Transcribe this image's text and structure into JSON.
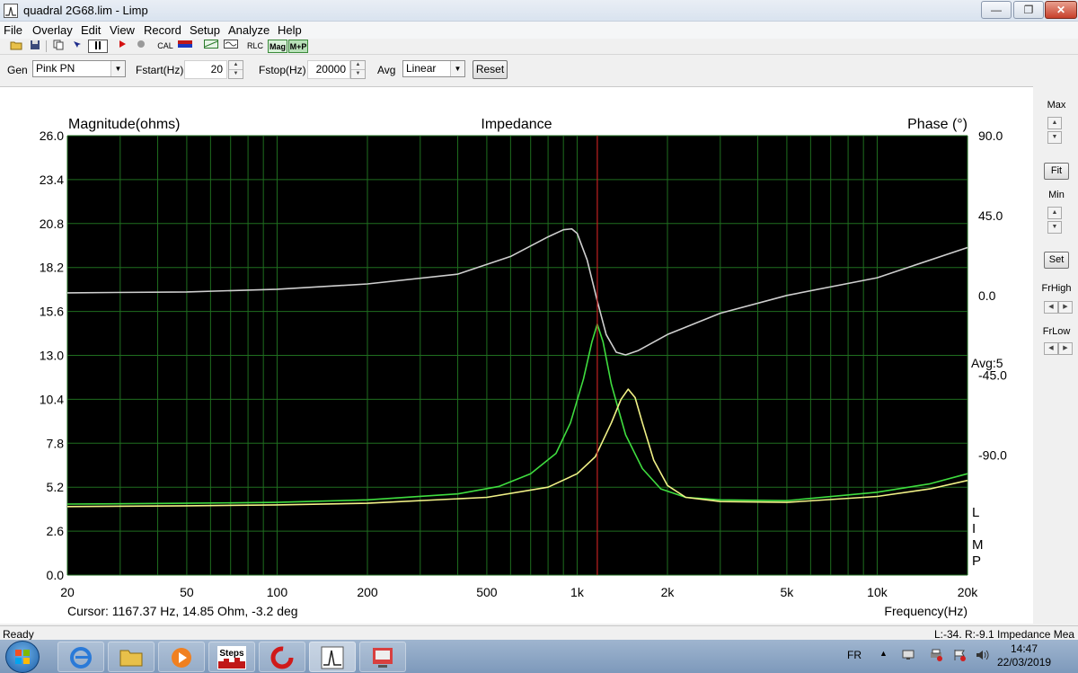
{
  "window": {
    "title": "quadral 2G68.lim - Limp",
    "minimize_glyph": "—",
    "maximize_glyph": "❐",
    "close_glyph": "✕"
  },
  "menu": [
    "File",
    "Overlay",
    "Edit",
    "View",
    "Record",
    "Setup",
    "Analyze",
    "Help"
  ],
  "toolbar": {
    "cal_label": "CAL",
    "rlc_label": "RLC",
    "mag_label": "Mag",
    "mp_label": "M+P"
  },
  "controls": {
    "gen_label": "Gen",
    "gen_value": "Pink PN",
    "fstart_label": "Fstart(Hz)",
    "fstart_value": "20",
    "fstop_label": "Fstop(Hz)",
    "fstop_value": "20000",
    "avg_label": "Avg",
    "avg_value": "Linear",
    "reset_label": "Reset"
  },
  "right_panel": {
    "max_label": "Max",
    "fit_label": "Fit",
    "min_label": "Min",
    "set_label": "Set",
    "frhigh_label": "FrHigh",
    "frlow_label": "FrLow"
  },
  "status": {
    "left": "Ready",
    "right": "L:-34. R:-9.1 Impedance Mea"
  },
  "taskbar": {
    "steps_label": "Steps",
    "lang": "FR",
    "time": "14:47",
    "date": "22/03/2019"
  },
  "colors": {
    "plot_bg": "#000000",
    "grid": "#1f6e1f",
    "magnitude": "#3fdc3f",
    "magnitude_overlay": "#f2f287",
    "phase": "#cfcfcf",
    "cursor": "#c02020"
  },
  "chart_data": {
    "type": "line",
    "title": "Impedance",
    "ylabel": "Magnitude(ohms)",
    "y2label": "Phase (°)",
    "xlabel": "Frequency(Hz)",
    "x_scale": "log",
    "xlim": [
      20,
      20000
    ],
    "ylim": [
      0,
      26
    ],
    "y2lim": [
      -157.5,
      90
    ],
    "x_ticks": [
      20,
      50,
      100,
      200,
      500,
      1000,
      2000,
      5000,
      10000,
      20000
    ],
    "x_tick_labels": [
      "20",
      "50",
      "100",
      "200",
      "500",
      "1k",
      "2k",
      "5k",
      "10k",
      "20k"
    ],
    "y_ticks": [
      26.0,
      23.4,
      20.8,
      18.2,
      15.6,
      13.0,
      10.4,
      7.8,
      5.2,
      2.6,
      0.0
    ],
    "y_tick_labels": [
      "26.0",
      "23.4",
      "20.8",
      "18.2",
      "15.6",
      "13.0",
      "10.4",
      "7.8",
      "5.2",
      "2.6",
      "0.0"
    ],
    "y2_ticks": [
      90.0,
      45.0,
      0.0,
      -45.0,
      -90.0
    ],
    "y2_tick_labels": [
      "90.0",
      "45.0",
      "0.0",
      "-45.0",
      "-90.0"
    ],
    "grid": true,
    "avg_text": "Avg:5",
    "side_letters": [
      "L",
      "I",
      "M",
      "P"
    ],
    "cursor": {
      "x": 1167.37,
      "text": "Cursor: 1167.37 Hz, 14.85 Ohm, -3.2 deg"
    },
    "series": [
      {
        "key": "magnitude",
        "axis": "left",
        "x": [
          20,
          50,
          100,
          200,
          400,
          550,
          700,
          850,
          950,
          1050,
          1120,
          1167,
          1220,
          1300,
          1450,
          1650,
          1900,
          2300,
          3000,
          5000,
          10000,
          15000,
          20000
        ],
        "y": [
          4.2,
          4.25,
          4.3,
          4.45,
          4.8,
          5.25,
          6.0,
          7.2,
          9.0,
          11.6,
          13.8,
          14.85,
          13.8,
          11.3,
          8.3,
          6.3,
          5.1,
          4.6,
          4.45,
          4.4,
          4.9,
          5.4,
          6.0
        ]
      },
      {
        "key": "magnitude_overlay",
        "axis": "left",
        "x": [
          20,
          50,
          100,
          200,
          500,
          800,
          1000,
          1150,
          1300,
          1400,
          1480,
          1560,
          1650,
          1800,
          2000,
          2300,
          3000,
          5000,
          10000,
          15000,
          20000
        ],
        "y": [
          4.05,
          4.1,
          4.15,
          4.25,
          4.6,
          5.2,
          6.0,
          7.0,
          9.0,
          10.4,
          11.0,
          10.5,
          9.0,
          6.8,
          5.3,
          4.6,
          4.35,
          4.3,
          4.65,
          5.1,
          5.6
        ]
      },
      {
        "key": "phase",
        "axis": "right",
        "x": [
          20,
          50,
          100,
          200,
          400,
          600,
          800,
          900,
          960,
          1000,
          1080,
          1167,
          1250,
          1350,
          1450,
          1600,
          2000,
          3000,
          5000,
          10000,
          20000
        ],
        "y": [
          1.5,
          2.0,
          3.5,
          6.5,
          12.0,
          22.0,
          33.0,
          37.0,
          37.5,
          35.0,
          20.0,
          -3.2,
          -22.0,
          -32.0,
          -33.5,
          -31.0,
          -22.0,
          -10.0,
          0.0,
          10.0,
          27.0
        ]
      }
    ]
  }
}
